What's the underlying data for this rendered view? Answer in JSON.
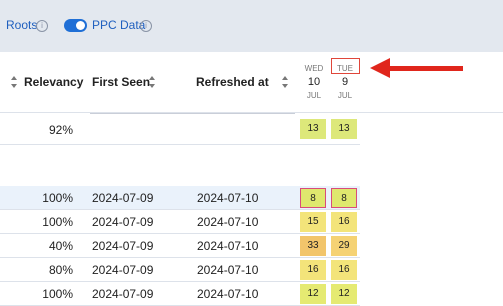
{
  "toolbar": {
    "roots_label": "Roots",
    "ppc_label": "PPC Data",
    "ppc_enabled": true
  },
  "columns": {
    "relevancy": "Relevancy",
    "first_seen": "First Seen",
    "refreshed_at": "Refreshed at"
  },
  "days": [
    {
      "dow": "WED",
      "day": "10",
      "month": "JUL"
    },
    {
      "dow": "TUE",
      "day": "9",
      "month": "JUL"
    }
  ],
  "summary_row": {
    "relevancy": "92%",
    "vol_wed": "13",
    "vol_tue": "13"
  },
  "rows": [
    {
      "relevancy": "100%",
      "first_seen": "2024-07-09",
      "refreshed_at": "2024-07-10",
      "vol_wed": "8",
      "vol_tue": "8",
      "color_wed": "#dfe86e",
      "color_tue": "#dfe86e"
    },
    {
      "relevancy": "100%",
      "first_seen": "2024-07-09",
      "refreshed_at": "2024-07-10",
      "vol_wed": "15",
      "vol_tue": "16",
      "color_wed": "#f3e47a",
      "color_tue": "#f3e47a"
    },
    {
      "relevancy": "40%",
      "first_seen": "2024-07-09",
      "refreshed_at": "2024-07-10",
      "vol_wed": "33",
      "vol_tue": "29",
      "color_wed": "#f2c56b",
      "color_tue": "#f5d274"
    },
    {
      "relevancy": "80%",
      "first_seen": "2024-07-09",
      "refreshed_at": "2024-07-10",
      "vol_wed": "16",
      "vol_tue": "16",
      "color_wed": "#f3e47a",
      "color_tue": "#f3e47a"
    },
    {
      "relevancy": "100%",
      "first_seen": "2024-07-09",
      "refreshed_at": "2024-07-10",
      "vol_wed": "12",
      "vol_tue": "12",
      "color_wed": "#e5ea72",
      "color_tue": "#e5ea72"
    }
  ],
  "colors": {
    "summary_cell": "#dde87a",
    "highlight_arrow": "#e0261c"
  }
}
